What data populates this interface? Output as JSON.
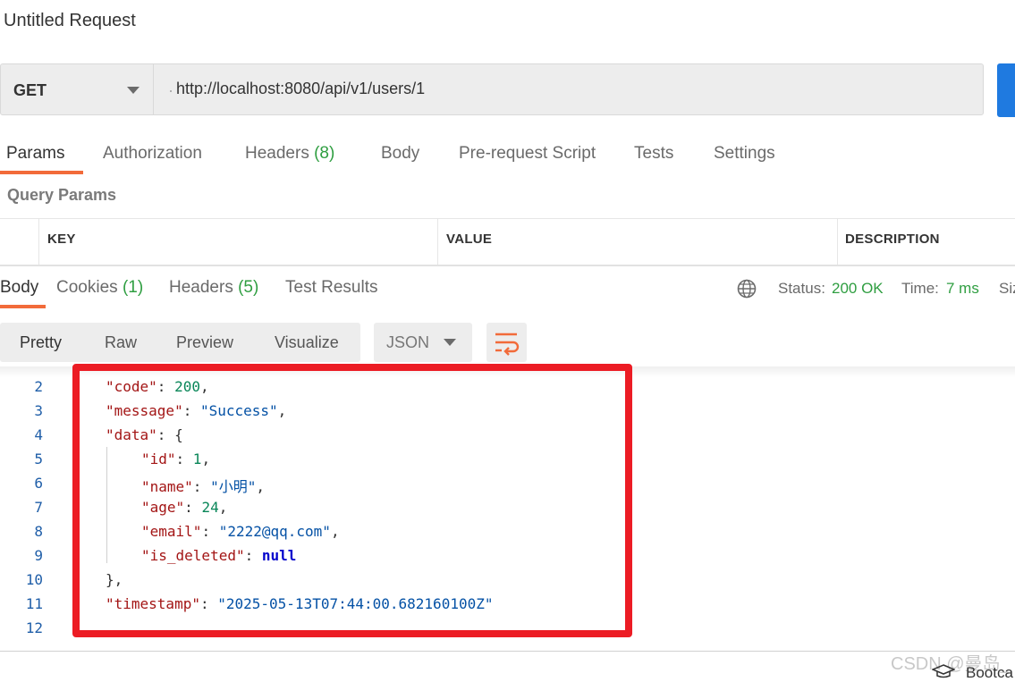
{
  "request": {
    "title": "Untitled Request",
    "method": "GET",
    "url": "http://localhost:8080/api/v1/users/1"
  },
  "request_tabs": {
    "params": "Params",
    "authorization": "Authorization",
    "headers": "Headers",
    "headers_count": "(8)",
    "body": "Body",
    "prerequest": "Pre-request Script",
    "tests": "Tests",
    "settings": "Settings"
  },
  "query_params": {
    "label": "Query Params",
    "columns": [
      "KEY",
      "VALUE",
      "DESCRIPTION"
    ]
  },
  "response_tabs": {
    "body": "Body",
    "cookies": "Cookies",
    "cookies_count": "(1)",
    "headers": "Headers",
    "headers_count": "(5)",
    "test_results": "Test Results"
  },
  "status": {
    "status_label": "Status:",
    "status_value": "200 OK",
    "time_label": "Time:",
    "time_value": "7 ms",
    "size_label": "Siz"
  },
  "format": {
    "pretty": "Pretty",
    "raw": "Raw",
    "preview": "Preview",
    "visualize": "Visualize",
    "type": "JSON"
  },
  "code": {
    "line_numbers": [
      "2",
      "3",
      "4",
      "5",
      "6",
      "7",
      "8",
      "9",
      "10",
      "11",
      "12"
    ],
    "code_key": "\"code\"",
    "code_val": "200",
    "message_key": "\"message\"",
    "message_val": "\"Success\"",
    "data_key": "\"data\"",
    "id_key": "\"id\"",
    "id_val": "1",
    "name_key": "\"name\"",
    "name_val": "\"小明\"",
    "age_key": "\"age\"",
    "age_val": "24",
    "email_key": "\"email\"",
    "email_val": "\"2222@qq.com\"",
    "deleted_key": "\"is_deleted\"",
    "deleted_val": "null",
    "timestamp_key": "\"timestamp\"",
    "timestamp_val": "\"2025-05-13T07:44:00.682160100Z\""
  },
  "footer": {
    "watermark": "CSDN @曼岛_",
    "bootcamp": "Bootca"
  },
  "colors": {
    "accent": "#f26b3a",
    "send": "#1f7ae0",
    "count_green": "#2f9e41",
    "highlight_box": "#ec1c24"
  }
}
